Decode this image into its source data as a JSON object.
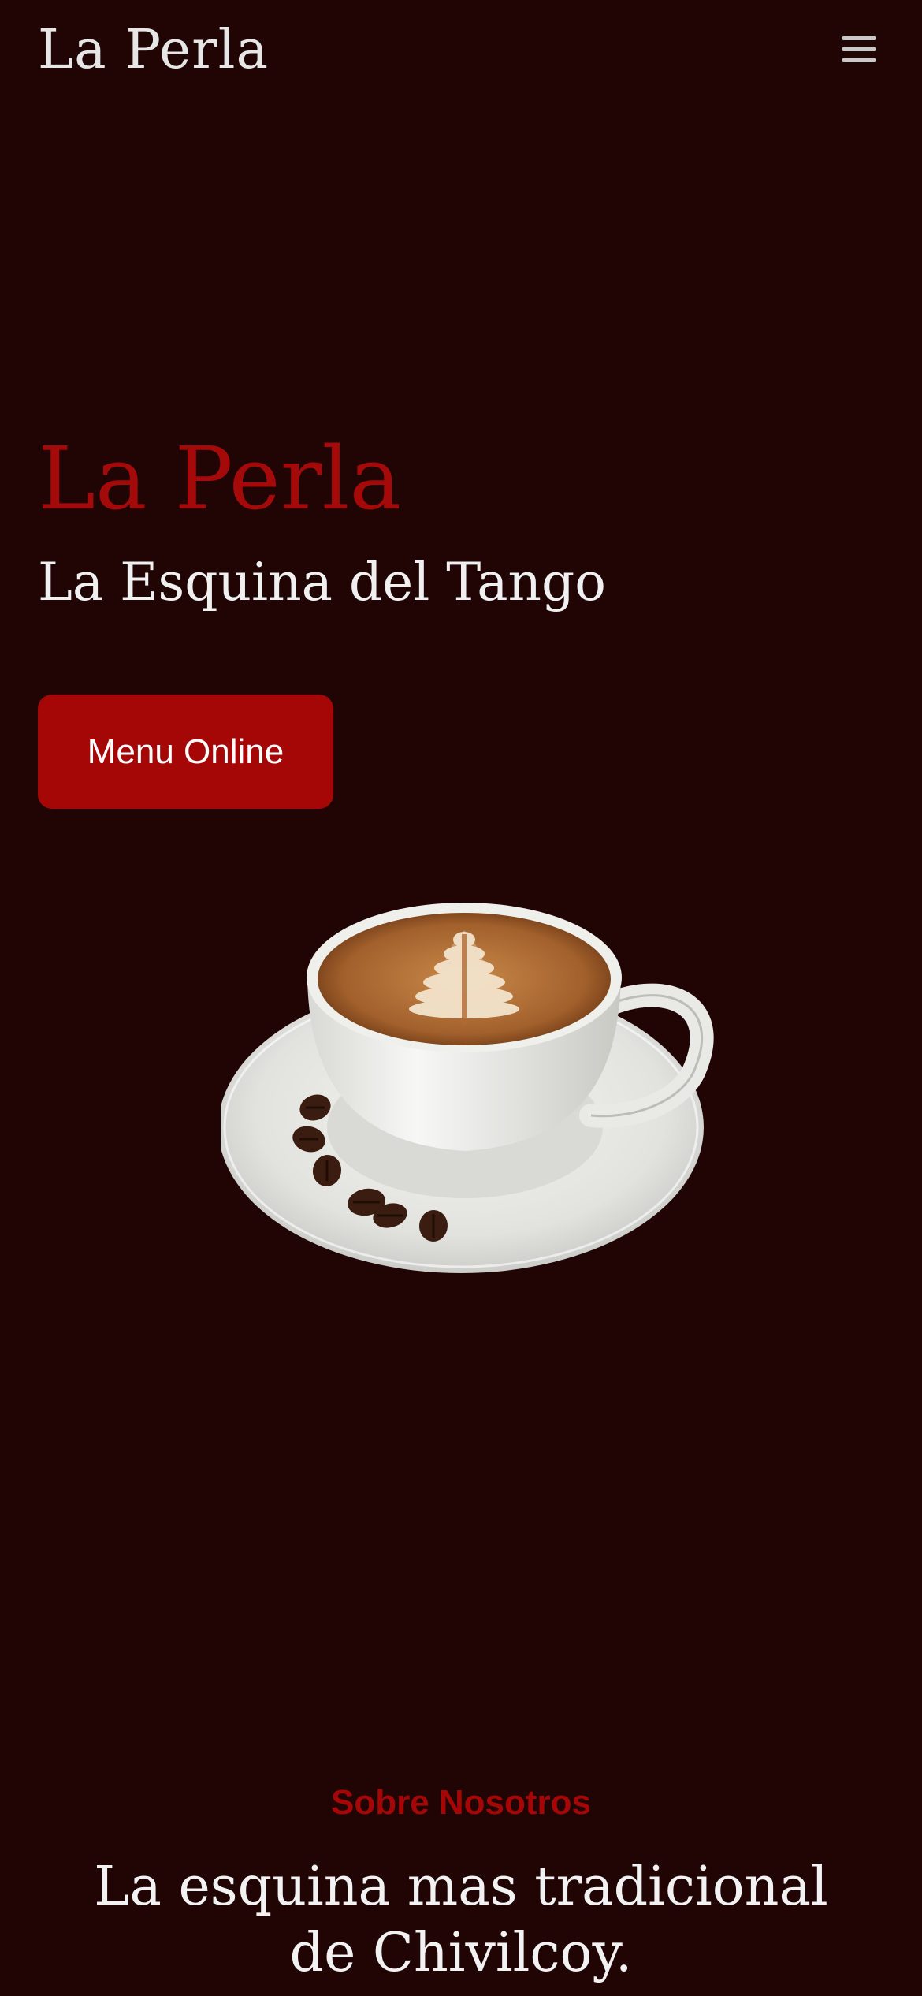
{
  "header": {
    "brand": "La Perla",
    "menu_icon": "hamburger-menu-icon"
  },
  "hero": {
    "title": "La Perla",
    "subtitle": "La Esquina del Tango",
    "cta_label": "Menu Online",
    "image": "coffee-cup-latte-art-with-coffee-beans"
  },
  "about": {
    "label": "Sobre Nosotros",
    "heading_line1": "La esquina mas tradicional",
    "heading_line2": "de Chivilcoy."
  },
  "colors": {
    "background": "#210404",
    "accent": "#a50707",
    "text_light": "#f0f0f0"
  }
}
